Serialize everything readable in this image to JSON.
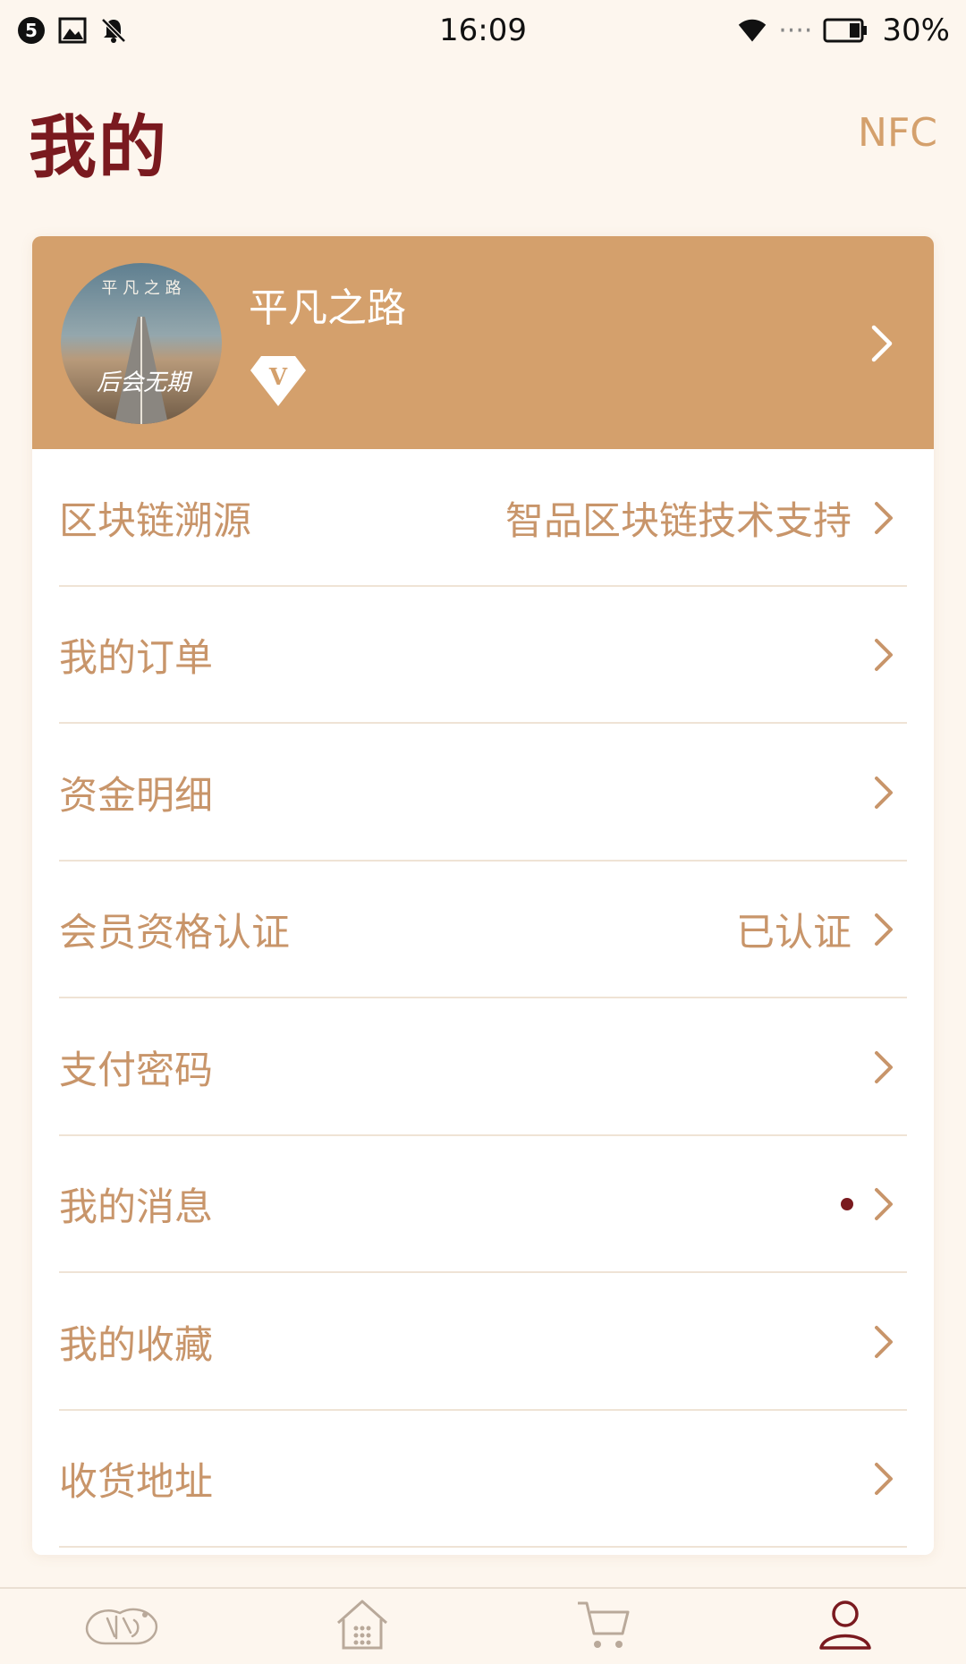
{
  "status_bar": {
    "notification_count": "5",
    "time": "16:09",
    "signal_dots": "····",
    "battery_percent": "30%"
  },
  "header": {
    "title": "我的",
    "nfc_label": "NFC"
  },
  "profile": {
    "name": "平凡之路",
    "vip_letter": "V",
    "avatar_top_text": "平 凡 之 路",
    "avatar_script_text": "后会无期"
  },
  "menu": {
    "items": [
      {
        "label": "区块链溯源",
        "value": "智品区块链技术支持"
      },
      {
        "label": "我的订单",
        "value": ""
      },
      {
        "label": "资金明细",
        "value": ""
      },
      {
        "label": "会员资格认证",
        "value": "已认证"
      },
      {
        "label": "支付密码",
        "value": ""
      },
      {
        "label": "我的消息",
        "value": ""
      },
      {
        "label": "我的收藏",
        "value": ""
      },
      {
        "label": "收货地址",
        "value": ""
      }
    ]
  },
  "colors": {
    "accent": "#d4a06c",
    "title": "#7a1a1f",
    "text": "#c8956a",
    "background": "#fdf6ee"
  },
  "tab_bar": {
    "tabs": [
      {
        "icon": "brand-logo-icon"
      },
      {
        "icon": "home-icon"
      },
      {
        "icon": "cart-icon"
      },
      {
        "icon": "user-icon"
      }
    ],
    "active_index": 3
  }
}
